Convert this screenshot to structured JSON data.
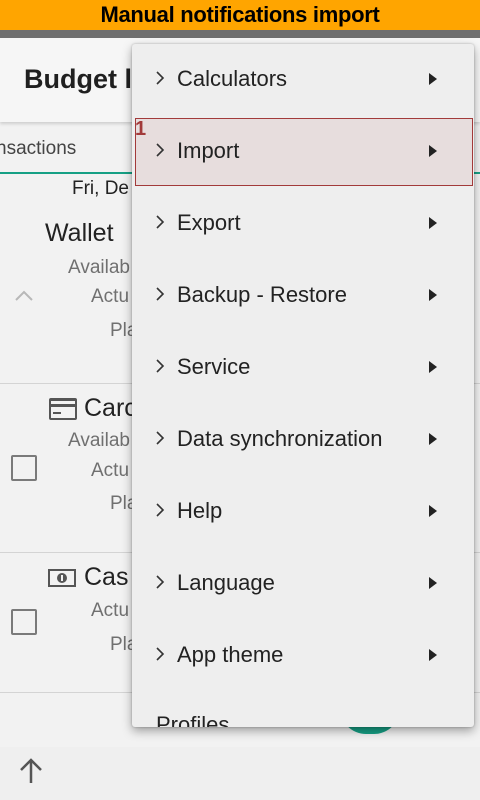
{
  "banner": {
    "title": "Manual notifications import"
  },
  "appbar": {
    "title": "Budget l"
  },
  "tabs": {
    "partial_label": "nsactions"
  },
  "list": {
    "date_label": "Fri, De",
    "accounts": [
      {
        "name": "Wallet",
        "lines": [
          "Availab",
          "Actu",
          "Pla"
        ]
      },
      {
        "name": "Carc",
        "lines": [
          "Availab",
          "Actu",
          "Pla"
        ]
      },
      {
        "name": "Cas",
        "lines": [
          "Actu",
          "Pla"
        ]
      }
    ]
  },
  "menu": {
    "items": [
      {
        "label": "Calculators"
      },
      {
        "label": "Import"
      },
      {
        "label": "Export"
      },
      {
        "label": "Backup - Restore"
      },
      {
        "label": "Service"
      },
      {
        "label": "Data synchronization"
      },
      {
        "label": "Help"
      },
      {
        "label": "Language"
      },
      {
        "label": "App theme"
      }
    ],
    "cut_item": "Profiles",
    "highlight_badge": "1"
  },
  "colors": {
    "banner": "#ffa500",
    "accent": "#16a085",
    "highlight_border": "#a23a3a",
    "highlight_fill": "#e7dddd"
  },
  "icons": {
    "menu_item_left": "chevron-right-icon",
    "menu_item_right": "submenu-arrow-icon",
    "account_collapse": "chevron-up-icon",
    "card": "credit-card-icon",
    "cash": "cash-icon",
    "scroll_top": "arrow-up-icon"
  }
}
